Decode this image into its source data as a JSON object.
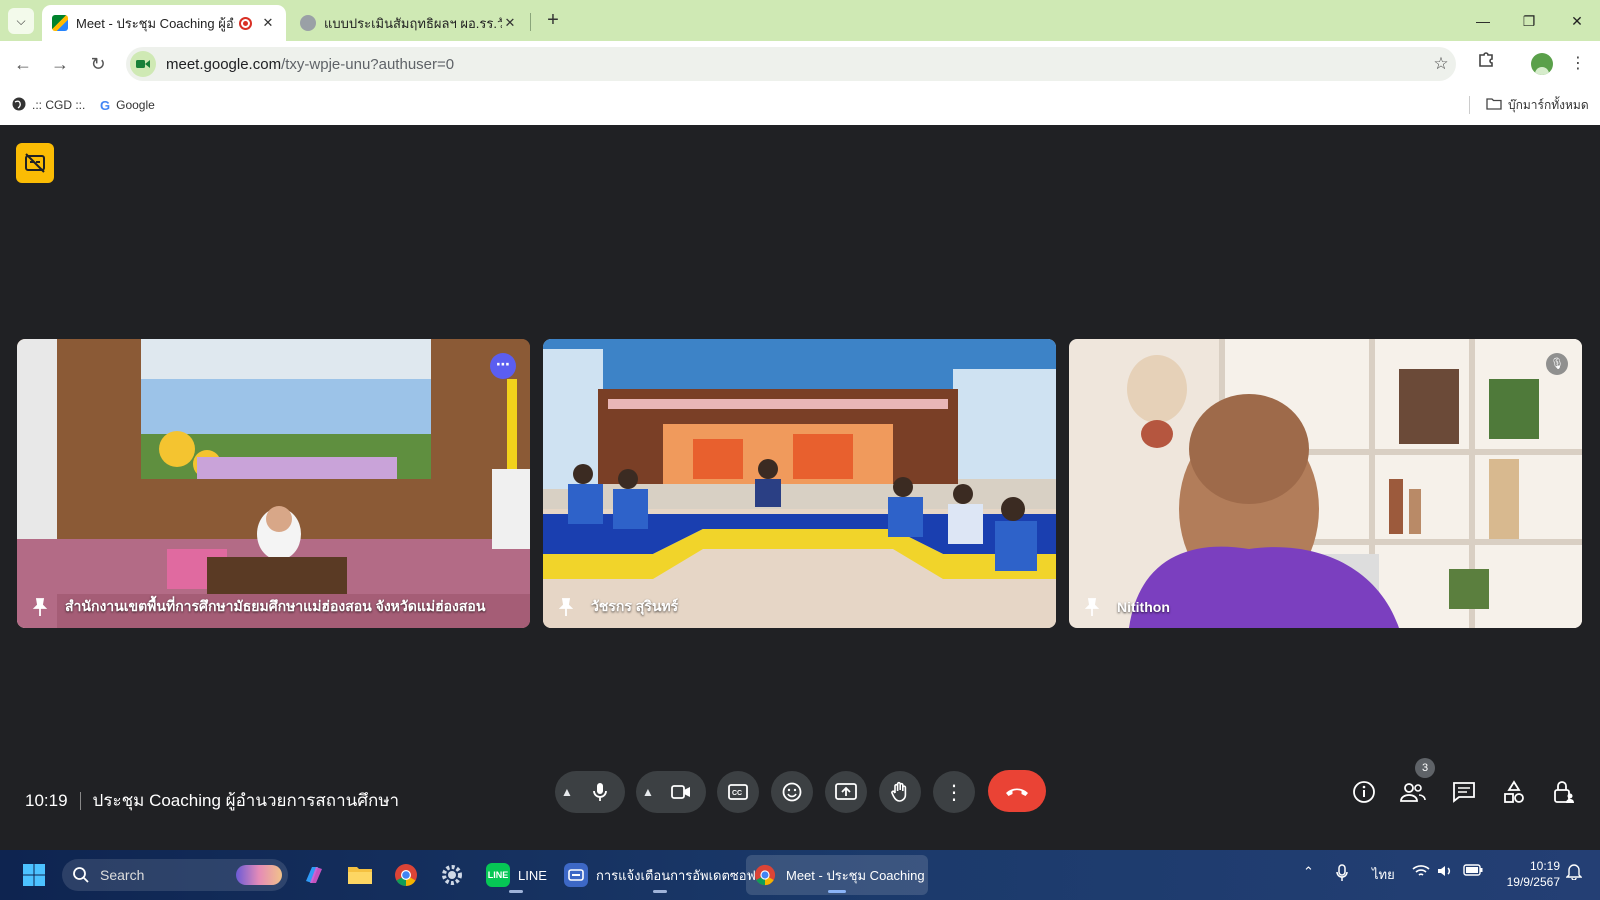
{
  "browser": {
    "tabs": [
      {
        "title": "Meet - ประชุม Coaching ผู้อำ",
        "active": true,
        "favicon_color": "#00832d"
      },
      {
        "title": "แบบประเมินสัมฤทธิผลฯ ผอ.รร.วัชรก",
        "active": false,
        "favicon_color": "#9aa0a6"
      }
    ],
    "url_host": "meet.google.com",
    "url_path": "/txy-wpje-unu?authuser=0",
    "bookmarks": [
      {
        "label": ".:: CGD ::.",
        "icon": "globe-icon"
      },
      {
        "label": "Google",
        "icon": "google-g-icon"
      }
    ],
    "all_bookmarks_label": "บุ๊กมาร์กทั้งหมด",
    "accent_color": "#cfe9b4"
  },
  "meet": {
    "time": "10:19",
    "meeting_title": "ประชุม Coaching ผู้อำนวยการสถานศึกษา",
    "participant_count": "3",
    "participants": [
      {
        "name": "สำนักงานเขตพื้นที่การศึกษามัธยมศึกษาแม่ฮ่องสอน จังหวัดแม่ฮ่องสอน"
      },
      {
        "name": "วัชรกร สุรินทร์"
      },
      {
        "name": "Nitithon"
      }
    ],
    "hangup_color": "#ea4335"
  },
  "taskbar": {
    "search_placeholder": "Search",
    "apps": [
      {
        "label": "LINE"
      },
      {
        "label": "การแจ้งเตือนการอัพเดตซอฟ"
      },
      {
        "label": "Meet - ประชุม Coaching"
      }
    ],
    "language": "ไทย",
    "clock_time": "10:19",
    "clock_date": "19/9/2567"
  }
}
